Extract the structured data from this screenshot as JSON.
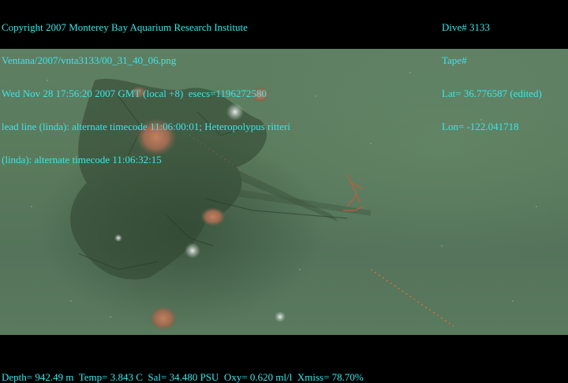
{
  "header_left": {
    "line1": "Copyright 2007 Monterey Bay Aquarium Research Institute",
    "line2": "Ventana/2007/vnta3133/00_31_40_06.png",
    "line3": "Wed Nov 28 17:56:20 2007 GMT (local +8)  esecs=1196272580",
    "line4": "lead line (linda): alternate timecode 11:06:00:01; Heteropolypus ritteri",
    "line5": "(linda): alternate timecode 11:06:32:15"
  },
  "header_right": {
    "dive": "Dive# 3133",
    "tape": "Tape#",
    "lat": "Lat= 36.776587 (edited)",
    "lon": "Lon= -122.041718"
  },
  "footer": {
    "telemetry": "Depth= 942.49 m  Temp= 3.843 C  Sal= 34.480 PSU  Oxy= 0.620 ml/l  Xmiss= 78.70%"
  },
  "colors": {
    "overlay_text": "#39e6ea",
    "water": "#5a7a5c",
    "letterbox": "#000000",
    "laser": "#ff6a3a"
  }
}
